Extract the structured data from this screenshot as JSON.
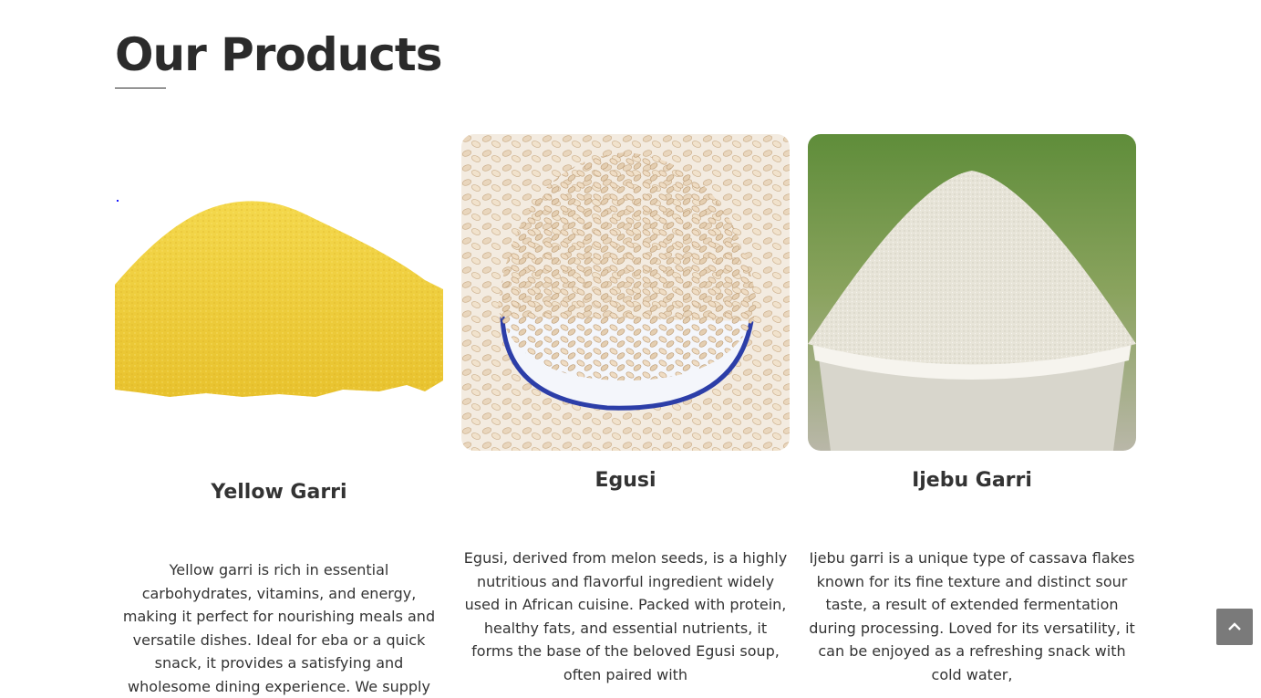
{
  "section": {
    "title": "Our Products"
  },
  "products": [
    {
      "name": "Yellow Garri",
      "description": "Yellow garri is rich in essential carbohydrates, vitamins, and energy, making it perfect for nourishing meals and versatile dishes. Ideal for eba or a quick snack, it provides a satisfying and wholesome dining experience. We supply",
      "image": "yellow-garri-heap"
    },
    {
      "name": "Egusi",
      "description": "Egusi, derived from melon seeds, is a highly nutritious and flavorful ingredient widely used in African cuisine. Packed with protein, healthy fats, and essential nutrients, it forms the base of the beloved Egusi soup, often paired with",
      "image": "egusi-seeds-bowl"
    },
    {
      "name": "Ijebu Garri",
      "description": "Ijebu garri is a unique type of cassava flakes known for its fine texture and distinct sour taste, a result of extended fermentation during processing. Loved for its versatility, it can be enjoyed as a refreshing snack with cold water,",
      "image": "ijebu-garri-bucket"
    }
  ],
  "back_to_top": {
    "icon": "chevron-up-icon"
  },
  "colors": {
    "heading": "#2b2b2b",
    "text": "#333333",
    "back_to_top_bg": "#7a7a7a"
  }
}
